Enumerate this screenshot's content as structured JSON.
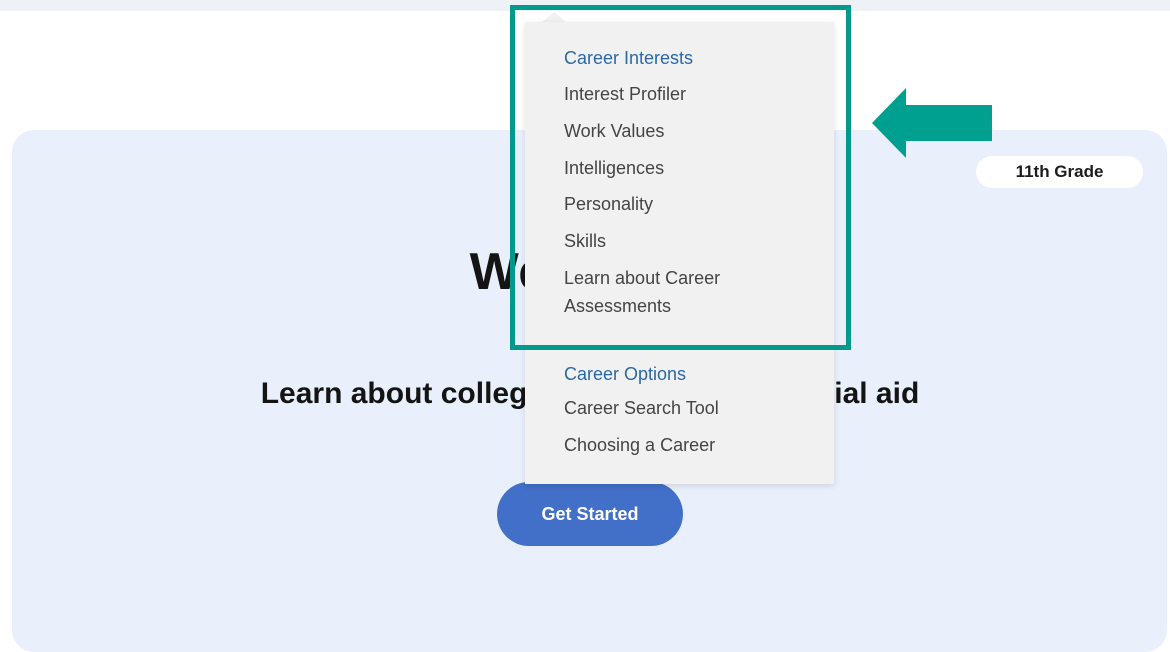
{
  "hero": {
    "grade_badge": "11th Grade",
    "title": "Welcome",
    "subtitle": "Learn about college, careers, and financial aid",
    "cta_label": "Get Started"
  },
  "dropdown": {
    "sections": [
      {
        "heading": "Career Interests",
        "items": [
          "Interest Profiler",
          "Work Values",
          "Intelligences",
          "Personality",
          "Skills",
          "Learn about Career Assessments"
        ]
      },
      {
        "heading": "Career Options",
        "items": [
          "Career Search Tool",
          "Choosing a Career"
        ]
      }
    ]
  },
  "annotation": {
    "highlight_color": "#009a8c",
    "arrow_icon": "arrow-left-icon"
  },
  "colors": {
    "hero_bg": "#e9f0fc",
    "button": "#4270c8",
    "menu_heading": "#2c68a5"
  }
}
